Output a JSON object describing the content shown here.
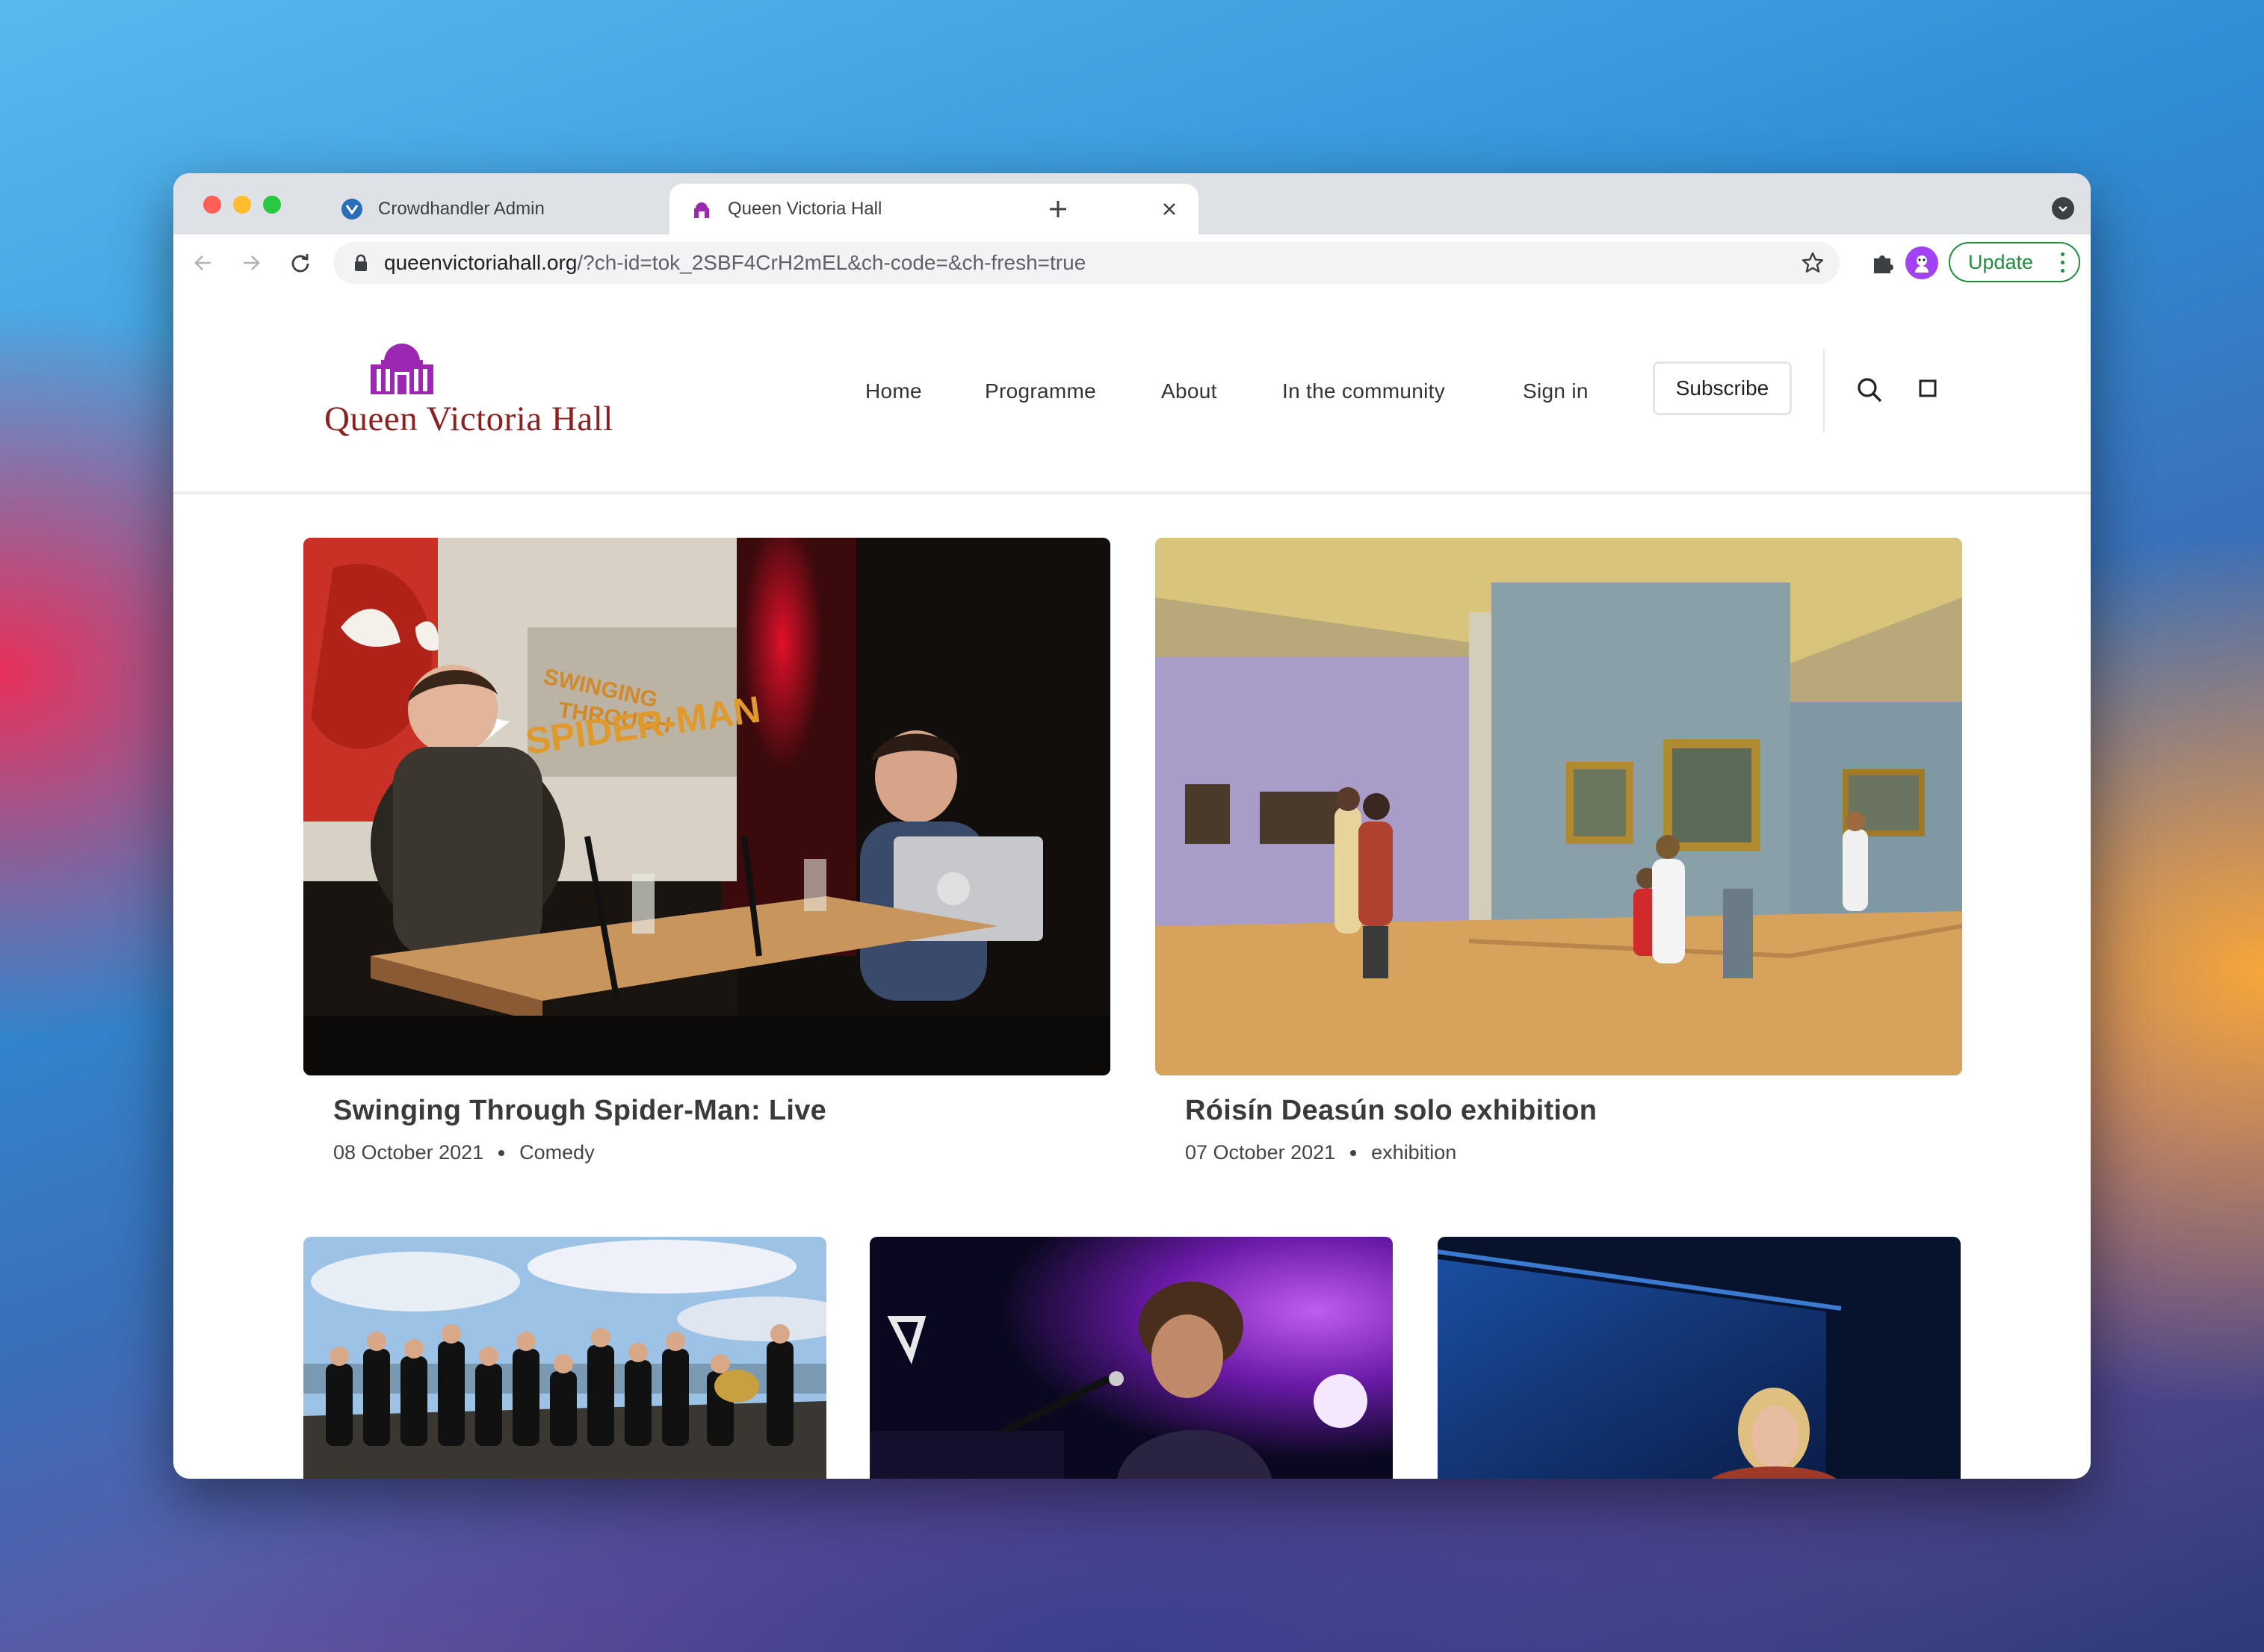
{
  "browser": {
    "tabs": [
      {
        "title": "Crowdhandler Admin",
        "active": false,
        "favicon": "crowdhandler-icon"
      },
      {
        "title": "Queen Victoria Hall",
        "active": true,
        "favicon": "hall-dome-icon"
      }
    ],
    "url_host": "queenvictoriahall.org",
    "url_rest": "/?ch-id=tok_2SBF4CrH2mEL&ch-code=&ch-fresh=true",
    "update_label": "Update",
    "accent": "#1e8e3e"
  },
  "site": {
    "logo_text": "Queen Victoria Hall",
    "brand_color": "#8b2020",
    "logo_icon_color": "#9c27b0",
    "nav": [
      "Home",
      "Programme",
      "About",
      "In the community",
      "Sign in"
    ],
    "subscribe_label": "Subscribe"
  },
  "posts": [
    {
      "title": "Swinging Through Spider-Man: Live",
      "date": "08 October 2021",
      "category": "Comedy",
      "image": "podcast-stage-photo"
    },
    {
      "title": "Róisín Deasún solo exhibition",
      "date": "07 October 2021",
      "category": "exhibition",
      "image": "gallery-interior-photo"
    },
    {
      "image": "orchestra-on-rocks-photo"
    },
    {
      "image": "pianist-singer-photo"
    },
    {
      "image": "speaker-on-stage-photo"
    }
  ]
}
